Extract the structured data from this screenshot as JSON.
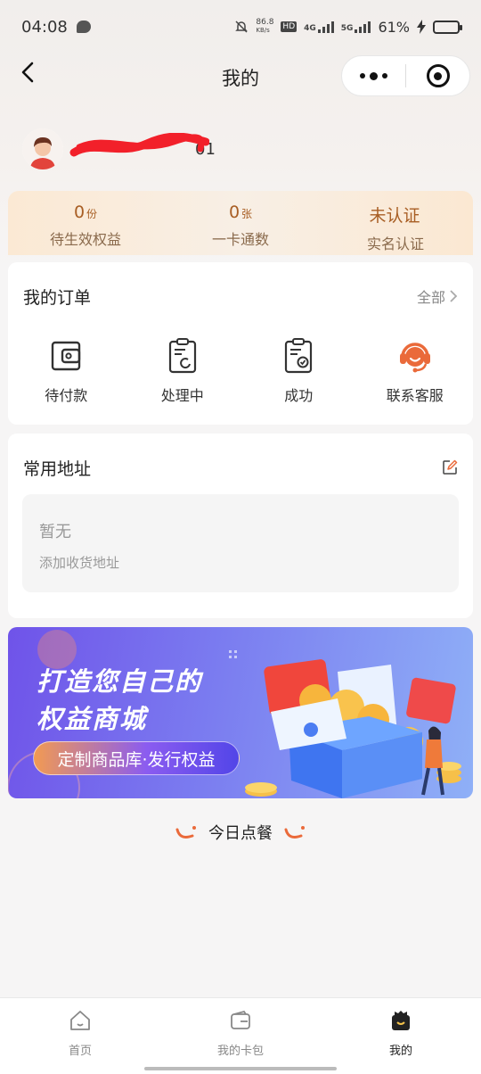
{
  "status_bar": {
    "time": "04:08",
    "net_speed_value": "86.8",
    "net_speed_unit": "KB/s",
    "hd_label": "HD",
    "sim1_label": "4G",
    "sim2_label": "5G",
    "battery_pct": "61%",
    "battery_level": 0.61
  },
  "nav": {
    "title": "我的"
  },
  "profile": {
    "name_suffix": "01"
  },
  "stats": [
    {
      "num": "0",
      "unit": "份",
      "label": "待生效权益"
    },
    {
      "num": "0",
      "unit": "张",
      "label": "一卡通数"
    },
    {
      "num": "未认证",
      "unit": "",
      "label": "实名认证"
    }
  ],
  "orders": {
    "title": "我的订单",
    "all_label": "全部",
    "items": [
      {
        "label": "待付款",
        "icon": "wallet-icon"
      },
      {
        "label": "处理中",
        "icon": "clipboard-processing-icon"
      },
      {
        "label": "成功",
        "icon": "clipboard-check-icon"
      },
      {
        "label": "联系客服",
        "icon": "customer-service-icon"
      }
    ]
  },
  "address": {
    "title": "常用地址",
    "empty_text": "暂无",
    "add_hint": "添加收货地址"
  },
  "banner": {
    "title_line1": "打造您自己的",
    "title_line2": "权益商城",
    "pill_text": "定制商品库·发行权益"
  },
  "today": {
    "label": "今日点餐"
  },
  "tabbar": {
    "tabs": [
      {
        "label": "首页",
        "icon": "home-icon"
      },
      {
        "label": "我的卡包",
        "icon": "card-wallet-icon"
      },
      {
        "label": "我的",
        "icon": "profile-bag-icon",
        "active": true
      }
    ]
  },
  "colors": {
    "accent_orange": "#ea6a3a",
    "stat_text": "#a85e24",
    "banner_start": "#6f53e9",
    "banner_end": "#8fb0f7"
  }
}
